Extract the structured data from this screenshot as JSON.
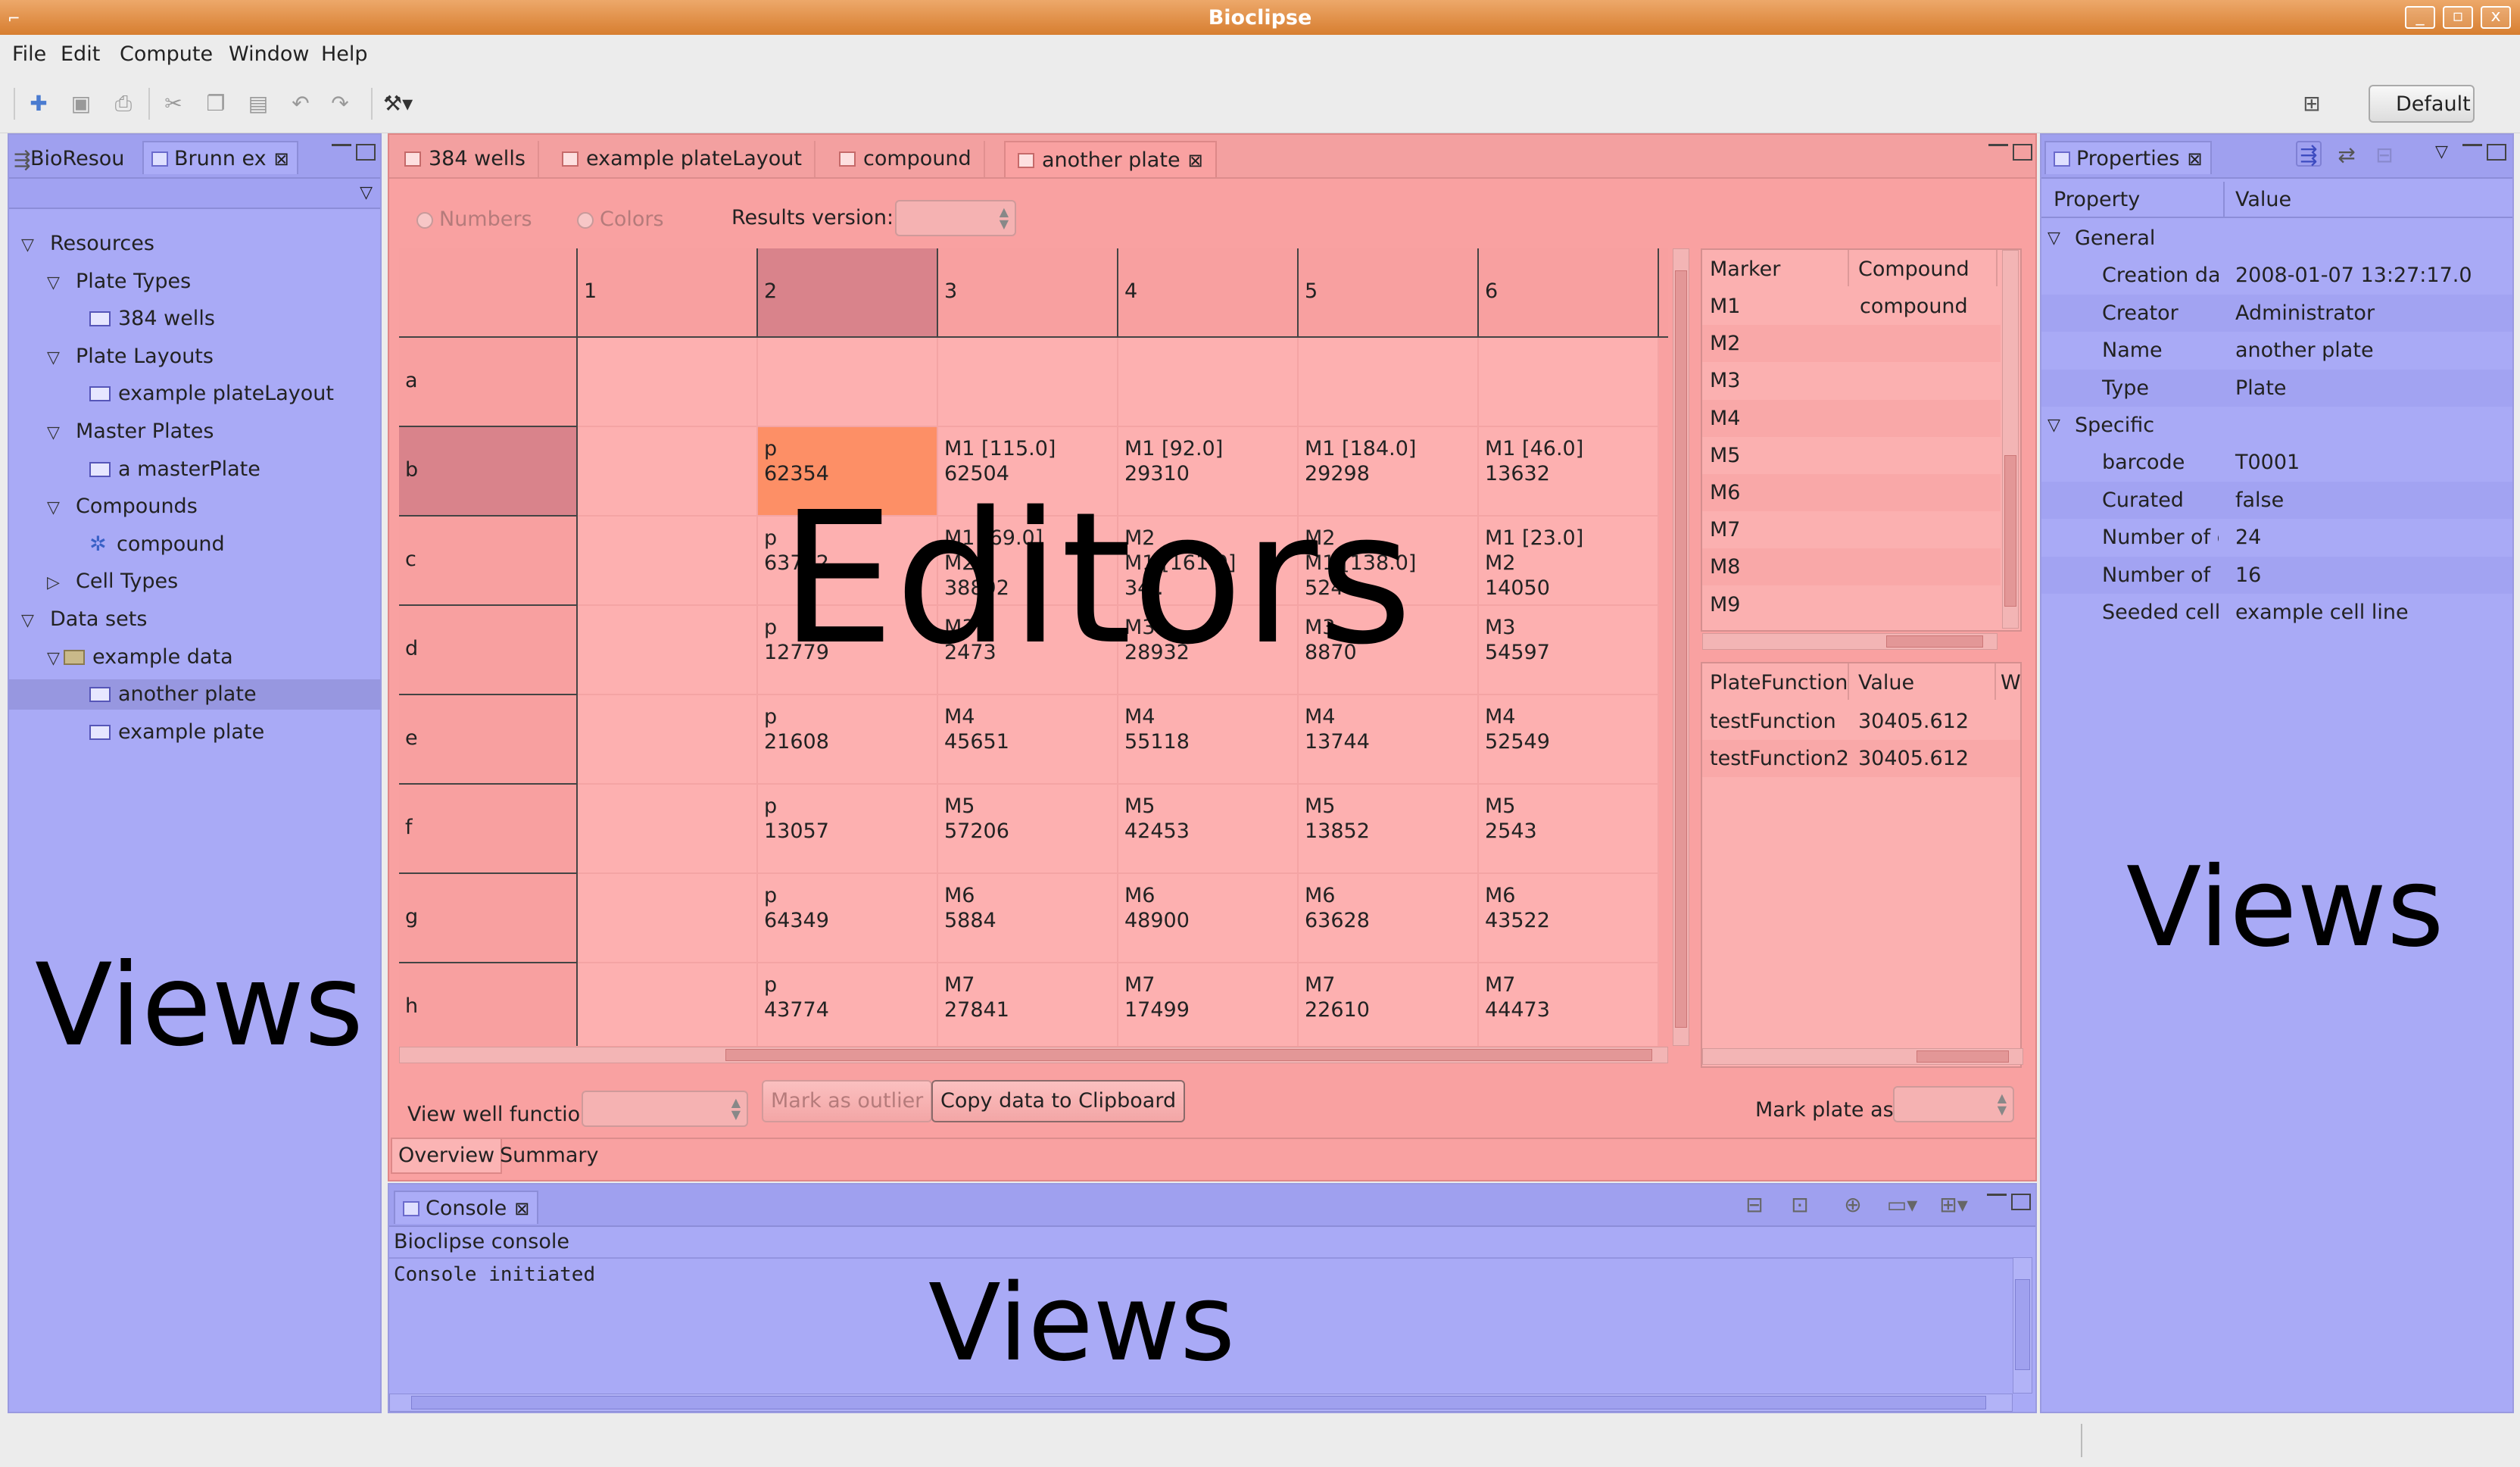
{
  "window": {
    "title": "Bioclipse",
    "buttons": [
      "_",
      "▫",
      "x"
    ]
  },
  "menu": [
    "File",
    "Edit",
    "Compute",
    "Window",
    "Help"
  ],
  "perspective": {
    "label": "Default"
  },
  "left_view": {
    "tabs": [
      "BioResou",
      "Brunn ex"
    ],
    "tree": [
      {
        "label": "Resources",
        "level": 0,
        "expanded": true
      },
      {
        "label": "Plate Types",
        "level": 1,
        "expanded": true
      },
      {
        "label": "384 wells",
        "level": 2,
        "icon": "plate-icon"
      },
      {
        "label": "Plate Layouts",
        "level": 1,
        "expanded": true
      },
      {
        "label": "example plateLayout",
        "level": 2,
        "icon": "layout-icon"
      },
      {
        "label": "Master Plates",
        "level": 1,
        "expanded": true
      },
      {
        "label": "a masterPlate",
        "level": 2,
        "icon": "plate-icon"
      },
      {
        "label": "Compounds",
        "level": 1,
        "expanded": true
      },
      {
        "label": "compound",
        "level": 2,
        "icon": "molecule-icon"
      },
      {
        "label": "Cell Types",
        "level": 1,
        "expanded": false
      },
      {
        "label": "Data sets",
        "level": 0,
        "expanded": true
      },
      {
        "label": "example data",
        "level": 1,
        "icon": "folder-icon",
        "expanded": true
      },
      {
        "label": "another plate",
        "level": 2,
        "icon": "plate-icon",
        "selected": true
      },
      {
        "label": "example plate",
        "level": 2,
        "icon": "plate-icon"
      }
    ],
    "overlay": "Views"
  },
  "editor": {
    "tabs": [
      "384 wells",
      "example plateLayout",
      "compound",
      "another plate"
    ],
    "active_tab": "another plate",
    "radios": [
      "Numbers",
      "Colors"
    ],
    "results_version_label": "Results version:",
    "columns": [
      "1",
      "2",
      "3",
      "4",
      "5",
      "6"
    ],
    "rows": [
      "a",
      "b",
      "c",
      "d",
      "e",
      "f",
      "g",
      "h"
    ],
    "cells": {
      "b": [
        "",
        "p\n62354",
        "M1 [115.0]\n62504",
        "M1 [92.0]\n29310",
        "M1 [184.0]\n29298",
        "M1 [46.0]\n13632"
      ],
      "c": [
        "",
        "p\n63762",
        "M1 [69.0]\nM2\n38892",
        "M2\nM1 [161.0]\n34..",
        "M2\nM1 [138.0]\n5246",
        "M1 [23.0]\nM2\n14050"
      ],
      "d": [
        "",
        "p\n12779",
        "M3\n2473",
        "M3\n28932",
        "M3\n8870",
        "M3\n54597"
      ],
      "e": [
        "",
        "p\n21608",
        "M4\n45651",
        "M4\n55118",
        "M4\n13744",
        "M4\n52549"
      ],
      "f": [
        "",
        "p\n13057",
        "M5\n57206",
        "M5\n42453",
        "M5\n13852",
        "M5\n2543"
      ],
      "g": [
        "",
        "p\n64349",
        "M6\n5884",
        "M6\n48900",
        "M6\n63628",
        "M6\n43522"
      ],
      "h": [
        "",
        "p\n43774",
        "M7\n27841",
        "M7\n17499",
        "M7\n22610",
        "M7\n44473"
      ]
    },
    "marker_table": {
      "headers": [
        "Marker",
        "Compound"
      ],
      "rows": [
        [
          "M1",
          "compound"
        ],
        [
          "M2",
          ""
        ],
        [
          "M3",
          ""
        ],
        [
          "M4",
          ""
        ],
        [
          "M5",
          ""
        ],
        [
          "M6",
          ""
        ],
        [
          "M7",
          ""
        ],
        [
          "M8",
          ""
        ],
        [
          "M9",
          ""
        ]
      ]
    },
    "function_table": {
      "headers": [
        "PlateFunction",
        "Value",
        "W"
      ],
      "rows": [
        [
          "testFunction",
          "30405.612"
        ],
        [
          "testFunction2",
          "30405.612"
        ]
      ]
    },
    "view_well_function_label": "View well function",
    "mark_outlier_label": "Mark as outlier",
    "copy_label": "Copy data to Clipboard",
    "mark_plate_label": "Mark plate as",
    "bottom_tabs": [
      "Overview",
      "Summary"
    ],
    "overlay": "Editors"
  },
  "console": {
    "tab": "Console",
    "header": "Bioclipse console",
    "text": "Console initiated",
    "overlay": "Views"
  },
  "properties": {
    "tab": "Properties",
    "headers": [
      "Property",
      "Value"
    ],
    "groups": [
      {
        "name": "General",
        "rows": [
          [
            "Creation dat",
            "2008-01-07 13:27:17.0"
          ],
          [
            "Creator",
            "Administrator"
          ],
          [
            "Name",
            "another plate"
          ],
          [
            "Type",
            "Plate"
          ]
        ]
      },
      {
        "name": "Specific",
        "rows": [
          [
            "barcode",
            "T0001"
          ],
          [
            "Curated",
            "false"
          ],
          [
            "Number of c",
            "24"
          ],
          [
            "Number of r",
            "16"
          ],
          [
            "Seeded cell t",
            "example cell line"
          ]
        ]
      }
    ],
    "overlay": "Views"
  },
  "colors": {
    "views": "#a9aaf6",
    "editors": "#f9a1a1",
    "title_bar": "#e69450"
  }
}
